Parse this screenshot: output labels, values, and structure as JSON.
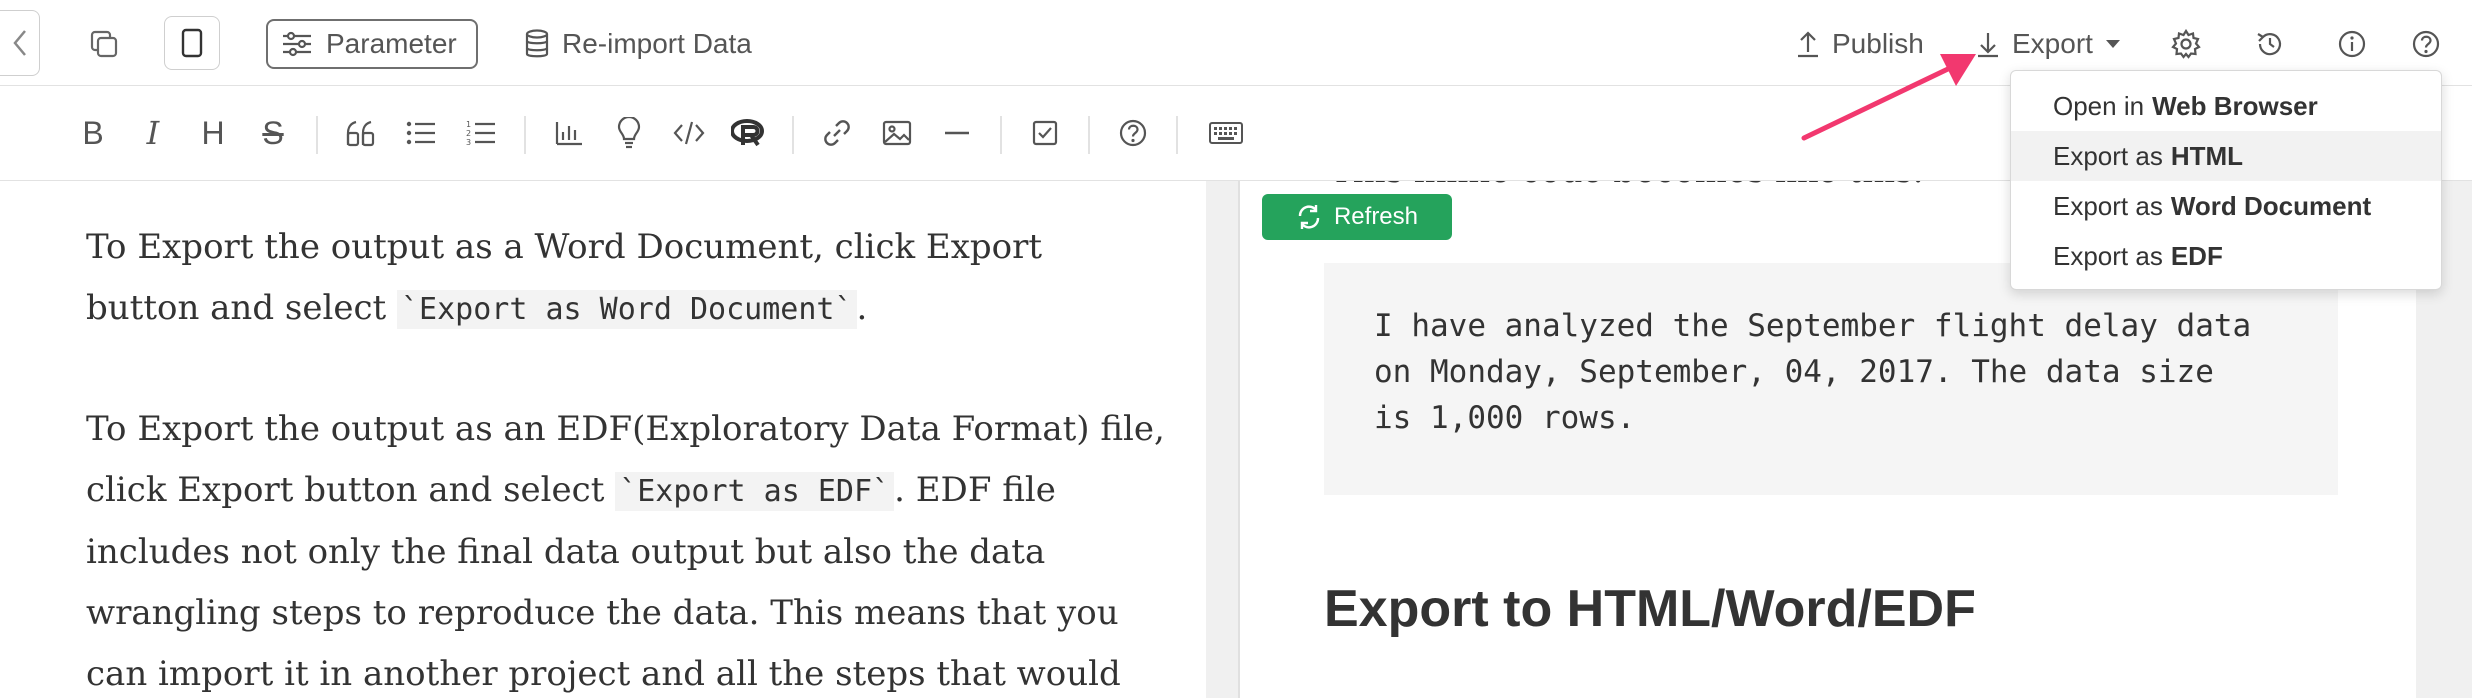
{
  "toolbar": {
    "parameter_label": "Parameter",
    "reimport_label": "Re-import Data",
    "publish_label": "Publish",
    "export_label": "Export"
  },
  "export_menu": {
    "items": [
      {
        "prefix": "Open in",
        "bold": "Web Browser"
      },
      {
        "prefix": "Export as",
        "bold": "HTML"
      },
      {
        "prefix": "Export as",
        "bold": "Word Document"
      },
      {
        "prefix": "Export as",
        "bold": "EDF"
      }
    ]
  },
  "formatting": {
    "bold": "B",
    "italic": "I",
    "heading": "H",
    "strike": "S"
  },
  "editor": {
    "p1_a": "To Export the output as a Word Document, click Export button and select ",
    "p1_code": "`Export as Word Document`",
    "p1_b": ".",
    "p2_a": "To Export the output as an EDF(Exploratory Data Format) file, click Export button and select ",
    "p2_code": "`Export as EDF`",
    "p2_b": ". EDF file includes not only the final data output but also the data wrangling steps to reproduce the data. This means that you can import it in another project and all the steps that would"
  },
  "preview": {
    "cut_text": "This inline code becomes like this:",
    "refresh_label": "Refresh",
    "code_lines": [
      "I have analyzed the September flight delay data",
      "on Monday, September, 04, 2017. The data size",
      "is 1,000 rows."
    ],
    "heading": "Export to HTML/Word/EDF"
  },
  "colors": {
    "accent_green": "#25a35c",
    "arrow_pink": "#f2386f"
  }
}
